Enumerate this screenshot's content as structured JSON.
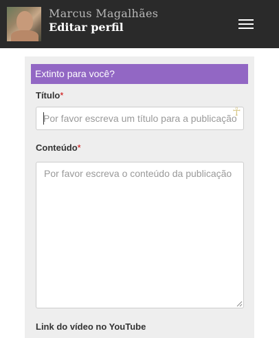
{
  "header": {
    "user_name": "Marcus Magalhães",
    "page_title": "Editar perfil",
    "menu_icon": "hamburger-menu-icon"
  },
  "alert": {
    "text": "Extinto para você?",
    "color": "#9267c4"
  },
  "form": {
    "title": {
      "label": "Título",
      "required_mark": "*",
      "placeholder": "Por favor escreva um título para a publicação",
      "value": ""
    },
    "content": {
      "label": "Conteúdo",
      "required_mark": "*",
      "placeholder": "Por favor escreva o conteúdo da publicação",
      "value": ""
    },
    "youtube": {
      "label": "Link do vídeo no YouTube"
    }
  },
  "icons": {
    "ankh": "☥"
  },
  "colors": {
    "topbar": "#2a2a2a",
    "panel": "#eeeeee",
    "required": "#cc0000"
  }
}
